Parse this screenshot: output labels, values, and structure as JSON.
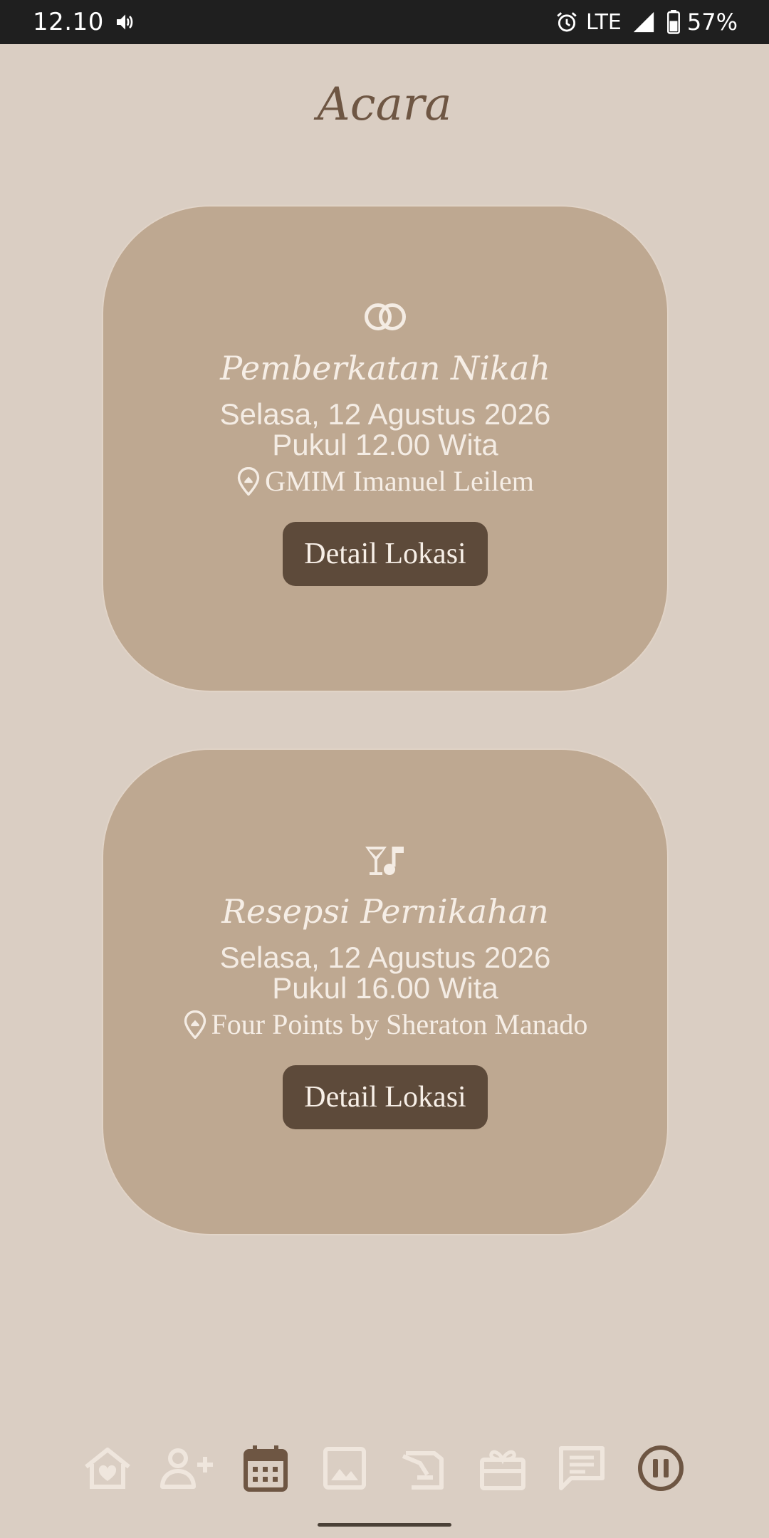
{
  "status_bar": {
    "time": "12.10",
    "network": "LTE",
    "battery": "57%",
    "icons": [
      "volume-icon",
      "alarm-icon",
      "signal-icon",
      "battery-icon"
    ]
  },
  "page": {
    "title": "Acara"
  },
  "events": [
    {
      "icon": "rings-icon",
      "title": "Pemberkatan Nikah",
      "date": "Selasa, 12 Agustus 2026",
      "time": "Pukul 12.00 Wita",
      "venue": "GMIM Imanuel Leilem",
      "button": "Detail Lokasi"
    },
    {
      "icon": "cocktail-music-icon",
      "title": "Resepsi Pernikahan",
      "date": "Selasa, 12 Agustus 2026",
      "time": "Pukul 16.00 Wita",
      "venue": "Four Points by Sheraton Manado",
      "button": "Detail Lokasi"
    }
  ],
  "bottom_nav": {
    "items": [
      "home-heart-icon",
      "add-person-icon",
      "calendar-icon",
      "gallery-icon",
      "book-icon",
      "gift-icon",
      "message-icon",
      "pause-icon"
    ],
    "active": "calendar-icon"
  },
  "colors": {
    "background": "#dacec3",
    "card": "#bea891",
    "button": "#5d4a3a",
    "title": "#6e5643",
    "nav_inactive": "#efe6dd",
    "nav_active": "#6e5643"
  }
}
